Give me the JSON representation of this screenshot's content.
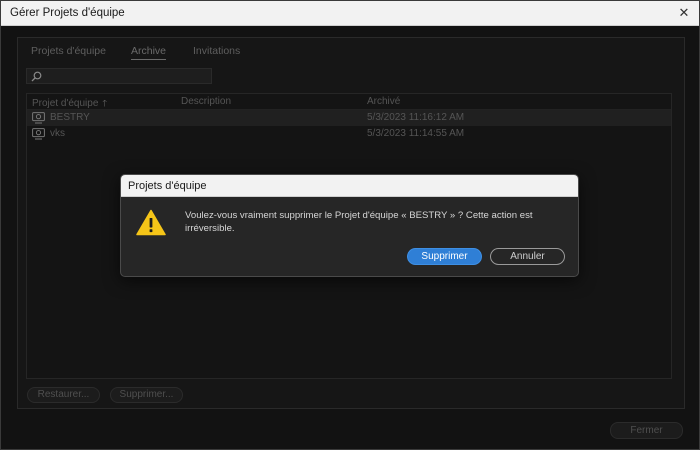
{
  "window": {
    "title": "Gérer Projets d'équipe",
    "close_glyph": "✕"
  },
  "tabs": [
    {
      "label": "Projets d'équipe",
      "active": false
    },
    {
      "label": "Archive",
      "active": true
    },
    {
      "label": "Invitations",
      "active": false
    }
  ],
  "search": {
    "value": "",
    "icon": "search-icon"
  },
  "table": {
    "columns": [
      {
        "label": "Projet d'équipe",
        "sort_glyph": "🡑",
        "sorted": "ascending"
      },
      {
        "label": "Description"
      },
      {
        "label": "Archivé"
      }
    ],
    "rows": [
      {
        "name": "BESTRY",
        "description": "",
        "archived": "5/3/2023 11:16:12 AM",
        "selected": true,
        "icon": "team-project-icon"
      },
      {
        "name": "vks",
        "description": "",
        "archived": "5/3/2023 11:14:55 AM",
        "selected": false,
        "icon": "team-project-icon"
      }
    ]
  },
  "actions": {
    "restore_label": "Restaurer...",
    "delete_label": "Supprimer..."
  },
  "footer": {
    "close_label": "Fermer"
  },
  "dialog": {
    "title": "Projets d'équipe",
    "icon": "warning-icon",
    "message": "Voulez-vous vraiment supprimer le Projet d'équipe « BESTRY » ? Cette action est irréversible.",
    "confirm_label": "Supprimer",
    "cancel_label": "Annuler"
  },
  "colors": {
    "accent": "#2f7fd6",
    "warning": "#f5c518",
    "background": "#121212"
  }
}
